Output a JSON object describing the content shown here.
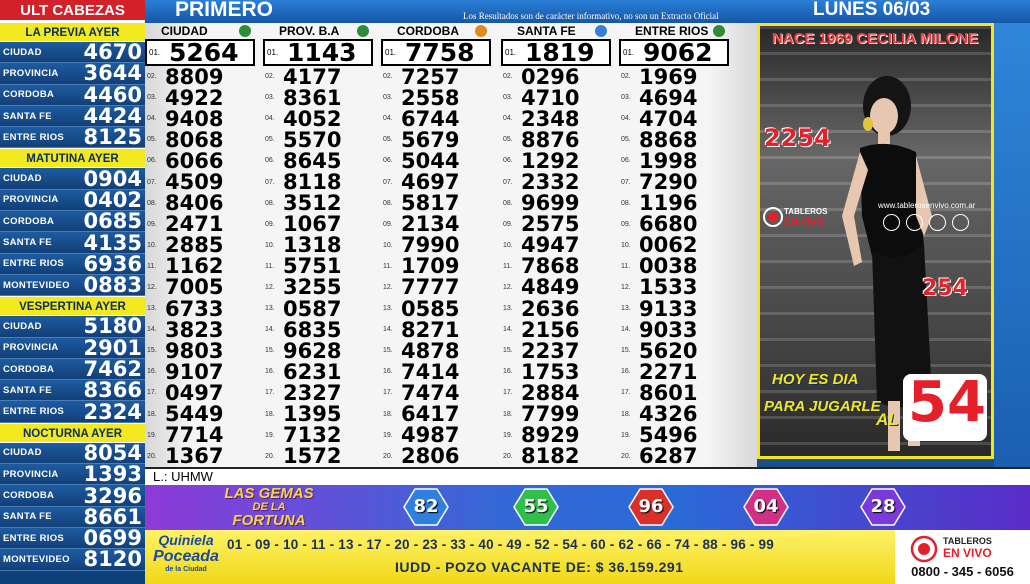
{
  "sidebar": {
    "header": "ULT CABEZAS",
    "sections": [
      {
        "title": "LA PREVIA AYER",
        "rows": [
          {
            "label": "CIUDAD",
            "value": "4670"
          },
          {
            "label": "PROVINCIA",
            "value": "3644"
          },
          {
            "label": "CORDOBA",
            "value": "4460"
          },
          {
            "label": "SANTA FE",
            "value": "4424"
          },
          {
            "label": "ENTRE RIOS",
            "value": "8125"
          }
        ]
      },
      {
        "title": "MATUTINA AYER",
        "rows": [
          {
            "label": "CIUDAD",
            "value": "0904"
          },
          {
            "label": "PROVINCIA",
            "value": "0402"
          },
          {
            "label": "CORDOBA",
            "value": "0685"
          },
          {
            "label": "SANTA FE",
            "value": "4135"
          },
          {
            "label": "ENTRE RIOS",
            "value": "6936"
          },
          {
            "label": "MONTEVIDEO",
            "value": "0883"
          }
        ]
      },
      {
        "title": "VESPERTINA AYER",
        "rows": [
          {
            "label": "CIUDAD",
            "value": "5180"
          },
          {
            "label": "PROVINCIA",
            "value": "2901"
          },
          {
            "label": "CORDOBA",
            "value": "7462"
          },
          {
            "label": "SANTA FE",
            "value": "8366"
          },
          {
            "label": "ENTRE RIOS",
            "value": "2324"
          }
        ]
      },
      {
        "title": "NOCTURNA AYER",
        "rows": [
          {
            "label": "CIUDAD",
            "value": "8054"
          },
          {
            "label": "PROVINCIA",
            "value": "1393"
          },
          {
            "label": "CORDOBA",
            "value": "3296"
          },
          {
            "label": "SANTA FE",
            "value": "8661"
          },
          {
            "label": "ENTRE RIOS",
            "value": "0699"
          },
          {
            "label": "MONTEVIDEO",
            "value": "8120"
          }
        ]
      }
    ]
  },
  "topbar": {
    "title": "PRIMERO",
    "note": "Los Resultados son de carácter informativo, no son un Extracto Oficial",
    "date": "LUNES  06/03"
  },
  "board": {
    "columns": [
      {
        "name": "CIUDAD",
        "numbers": [
          "5264",
          "8809",
          "4922",
          "9408",
          "8068",
          "6066",
          "4509",
          "8406",
          "2471",
          "2885",
          "1162",
          "7005",
          "6733",
          "3823",
          "9803",
          "9107",
          "0497",
          "5449",
          "7714",
          "1367"
        ]
      },
      {
        "name": "PROV. B.A",
        "numbers": [
          "1143",
          "4177",
          "8361",
          "4052",
          "5570",
          "8645",
          "8118",
          "3512",
          "1067",
          "1318",
          "5751",
          "3255",
          "0587",
          "6835",
          "9628",
          "6231",
          "2327",
          "1395",
          "7132",
          "1572"
        ]
      },
      {
        "name": "CORDOBA",
        "numbers": [
          "7758",
          "7257",
          "2558",
          "6744",
          "5679",
          "5044",
          "4697",
          "5817",
          "2134",
          "7990",
          "1709",
          "7777",
          "0585",
          "8271",
          "4878",
          "7414",
          "7474",
          "6417",
          "4987",
          "2806"
        ]
      },
      {
        "name": "SANTA FE",
        "numbers": [
          "1819",
          "0296",
          "4710",
          "2348",
          "8876",
          "1292",
          "2332",
          "9699",
          "2575",
          "4947",
          "7868",
          "4849",
          "2636",
          "2156",
          "2237",
          "1753",
          "2884",
          "7799",
          "8929",
          "8182"
        ]
      },
      {
        "name": "ENTRE RIOS",
        "numbers": [
          "9062",
          "1969",
          "4694",
          "4704",
          "8868",
          "1998",
          "7290",
          "1196",
          "6680",
          "0062",
          "0038",
          "1533",
          "9133",
          "9033",
          "5620",
          "2271",
          "8601",
          "4326",
          "5496",
          "6287"
        ]
      }
    ],
    "positions": [
      "01.",
      "02.",
      "03.",
      "04.",
      "05.",
      "06.",
      "07.",
      "08.",
      "09.",
      "10.",
      "11.",
      "12.",
      "13.",
      "14.",
      "15.",
      "16.",
      "17.",
      "18.",
      "19.",
      "20."
    ],
    "lucky_letters": "L.: UHMW"
  },
  "promo": {
    "title": "NACE 1969 CECILIA MILONE",
    "num_a": "2254",
    "num_b": "254",
    "cta_line1": "HOY ES DIA",
    "cta_line2": "PARA JUGARLE",
    "cta_al": "AL",
    "cta_number": "54",
    "site": "www.tablerosenvivo.com.ar",
    "logo_line1": "TABLEROS",
    "logo_line2": "EN VIVO"
  },
  "gems": {
    "logo_line1": "LAS GEMAS",
    "logo_line2": "DE LA",
    "logo_line3": "FORTUNA",
    "balls": [
      {
        "value": "82",
        "color": "#2f7fe0"
      },
      {
        "value": "55",
        "color": "#2fbf4a"
      },
      {
        "value": "96",
        "color": "#d9302a"
      },
      {
        "value": "04",
        "color": "#d22f86"
      },
      {
        "value": "28",
        "color": "#7a3ad9"
      }
    ]
  },
  "quiniela": {
    "logo_line1": "Quiniela",
    "logo_line2": "Poceada",
    "logo_line3": "de la Ciudad",
    "numbers": "01 - 09 - 10 - 11 - 13 - 17 - 20 - 23 - 33 - 40 - 49 - 52 - 54 - 60 - 62 - 66 - 74 - 88 - 96 - 99",
    "pozo": "IUDD - POZO VACANTE DE: $ 36.159.291"
  },
  "footer_logo": {
    "line1": "TABLEROS",
    "line2": "EN VIVO",
    "phone": "0800 - 345 - 6056"
  }
}
